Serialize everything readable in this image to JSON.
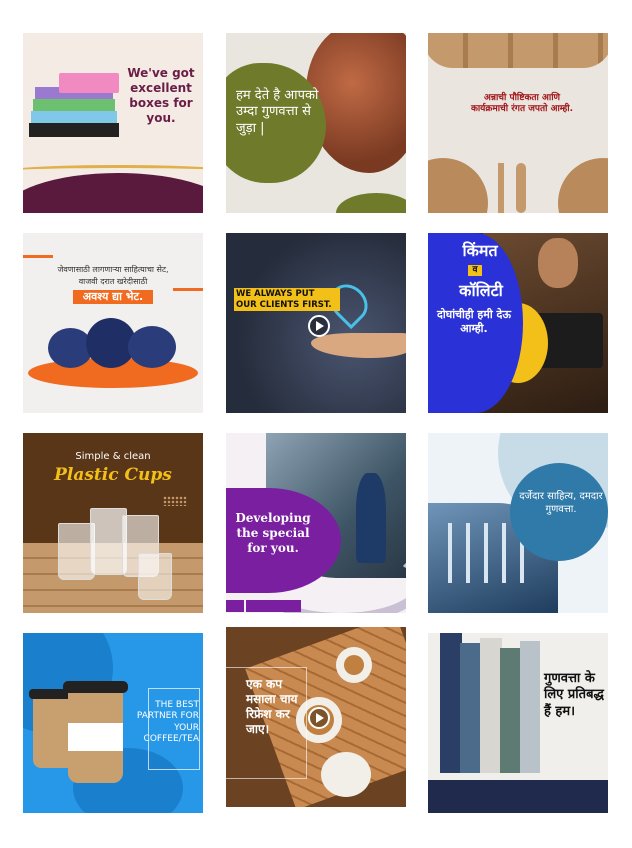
{
  "tiles": {
    "boxes": {
      "text": "We've got excellent boxes for you."
    },
    "clay": {
      "text": "हम देते है आपको उम्दा गुणवत्ता से जुड़ा |"
    },
    "plates": {
      "text": "अन्नाची पौष्टिकता आणि कार्यक्रमाची रंगत जपतो आम्ही."
    },
    "dinnerware": {
      "line1": "जेवणासाठी लागणाऱ्या साहित्याचा सेट,",
      "line2": "वाजवी दरात खरेदीसाठी",
      "cta": "अवश्य द्या भेट."
    },
    "clients": {
      "text": "WE ALWAYS PUT OUR CLIENTS FIRST."
    },
    "leather": {
      "w1": "किंमत",
      "w2": "व",
      "w3": "कॉलिटी",
      "w4": "दोघांचीही हमी देऊ आम्ही."
    },
    "cups": {
      "line1": "Simple & clean",
      "line2": "Plastic Cups"
    },
    "factory": {
      "text": "Developing the special for you."
    },
    "machine": {
      "text": "दर्जेदार साहित्य, दमदार गुणवत्ता."
    },
    "coffee": {
      "text": "THE BEST PARTNER FOR YOUR COFFEE/TEA"
    },
    "tea": {
      "text": "एक कप मसाला चाय रिफ्रेश कर जाए।"
    },
    "fabric": {
      "text": "गुणवत्ता के लिए प्रतिबद्ध हैं हम।"
    }
  },
  "colors": {
    "purple": "#5a1a3e",
    "violet": "#7a1fa0",
    "blue": "#2a31d6",
    "yellow": "#f2c018",
    "orange": "#f06a1f",
    "sky": "#2797e8",
    "brown": "#5a3618",
    "navy": "#1f2a4d"
  }
}
